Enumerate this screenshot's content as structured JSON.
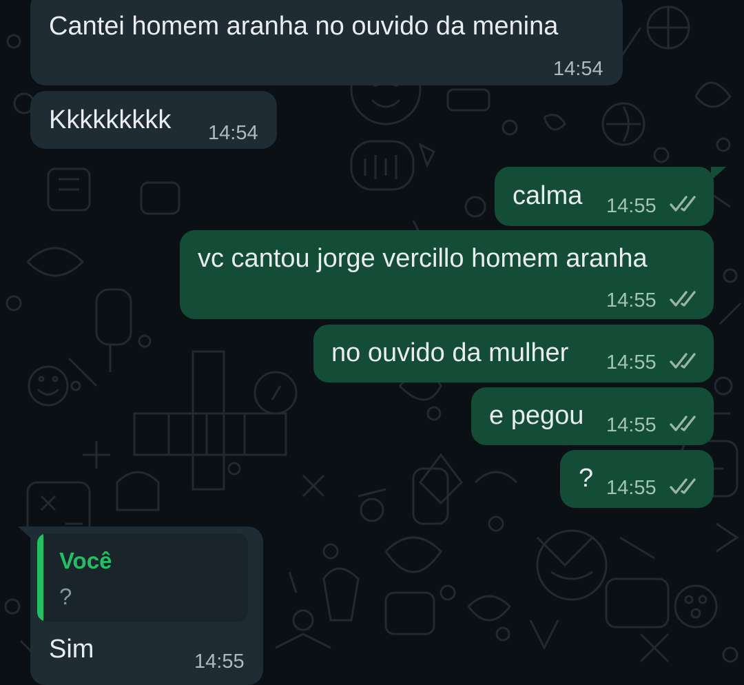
{
  "colors": {
    "background": "#0b1014",
    "incoming_bubble": "#1f2c33",
    "outgoing_bubble": "#144d37",
    "quote_accent": "#21c063"
  },
  "messages": [
    {
      "direction": "incoming",
      "text": "Cantei homem aranha no ouvido da menina",
      "time": "14:54"
    },
    {
      "direction": "incoming",
      "text": "Kkkkkkkkk",
      "time": "14:54"
    },
    {
      "direction": "outgoing",
      "text": "calma",
      "time": "14:55",
      "status": "read-double-check-icon"
    },
    {
      "direction": "outgoing",
      "text": "vc cantou jorge vercillo homem aranha",
      "time": "14:55",
      "status": "read-double-check-icon"
    },
    {
      "direction": "outgoing",
      "text": "no ouvido da mulher",
      "time": "14:55",
      "status": "read-double-check-icon"
    },
    {
      "direction": "outgoing",
      "text": "e pegou",
      "time": "14:55",
      "status": "read-double-check-icon"
    },
    {
      "direction": "outgoing",
      "text": "?",
      "time": "14:55",
      "status": "read-double-check-icon"
    },
    {
      "direction": "incoming",
      "text": "Sim",
      "time": "14:55",
      "quoted": {
        "author": "Você",
        "text": "?"
      }
    }
  ]
}
